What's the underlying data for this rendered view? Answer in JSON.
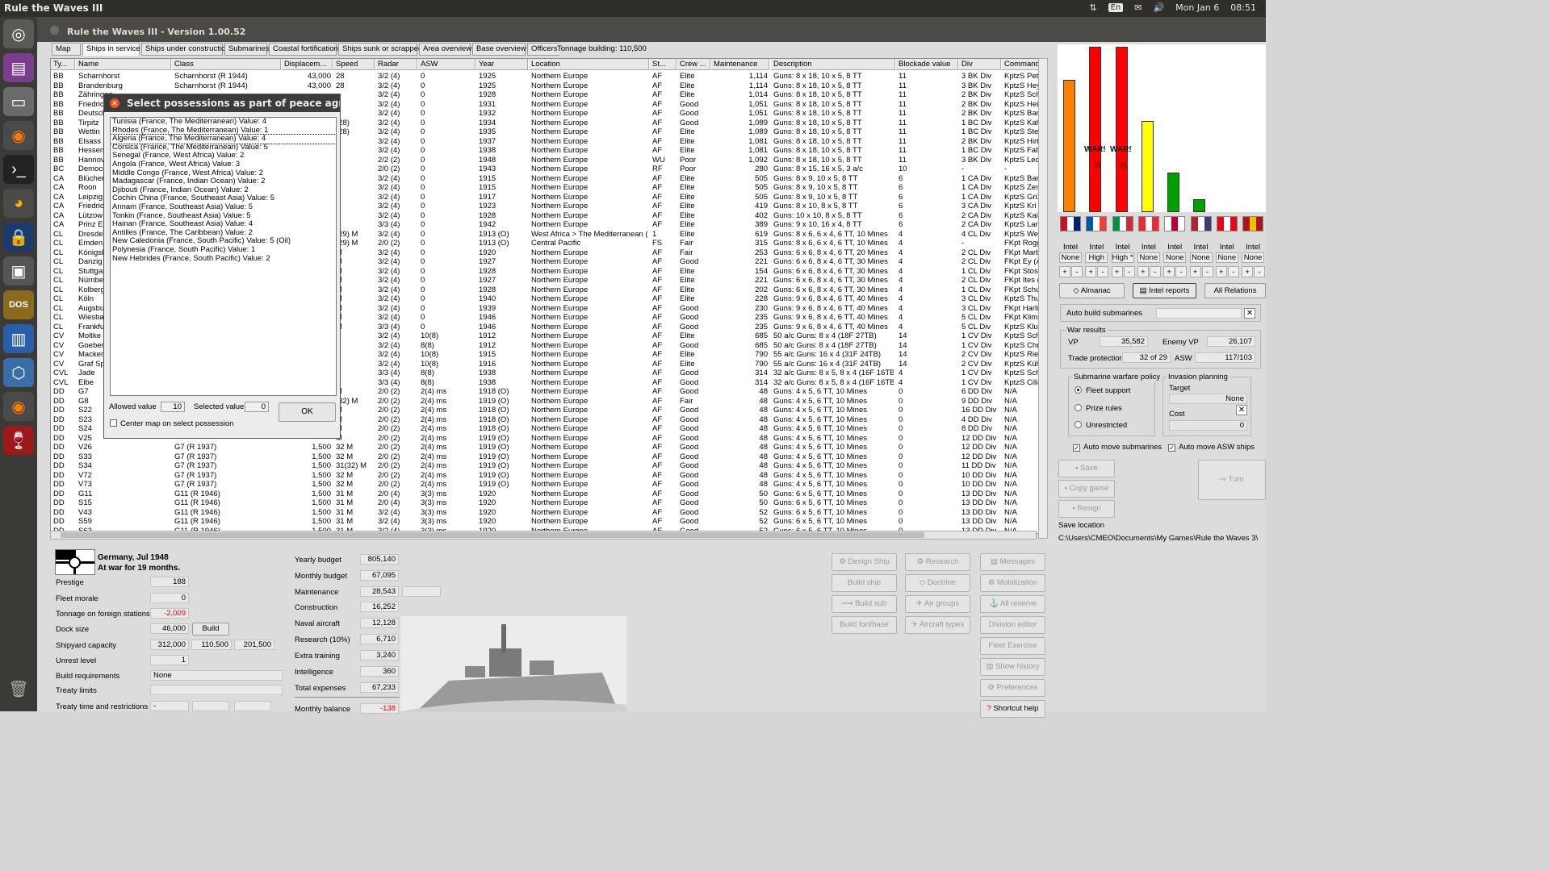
{
  "topbar": {
    "app_title": "Rule the Waves III",
    "keyboard": "En",
    "date": "Mon Jan 6",
    "time": "08:51"
  },
  "window": {
    "title": "Rule the Waves III - Version 1.00.52"
  },
  "tabs": [
    "Map",
    "Ships in service",
    "Ships under construction",
    "Submarines",
    "Coastal fortifications",
    "Ships sunk or scrapped",
    "Area overview",
    "Base overview",
    "Officers",
    "Tonnage building: 110,500"
  ],
  "columns": [
    "Ty...",
    "Name",
    "Class",
    "Displacem...",
    "Speed",
    "Radar",
    "ASW",
    "Year",
    "Location",
    "St...",
    "Crew ...",
    "Maintenance",
    "Description",
    "Blockade value",
    "Div",
    "Command"
  ],
  "ships": [
    [
      "BB",
      "Scharnhorst",
      "Scharnhorst (R 1944)",
      "43,000",
      "28",
      "3/2 (4)",
      "0",
      "1925",
      "Northern Europe",
      "AF",
      "Elite",
      "1,114",
      "Guns: 8 x 18, 10 x 5, 8 TT",
      "11",
      "3 BK Div",
      "KptzS Pet"
    ],
    [
      "BB",
      "Brandenburg",
      "Scharnhorst (R 1944)",
      "43,000",
      "28",
      "3/2 (4)",
      "0",
      "1925",
      "Northern Europe",
      "AF",
      "Elite",
      "1,114",
      "Guns: 8 x 18, 10 x 5, 8 TT",
      "11",
      "3 BK Div",
      "KptzS Hey"
    ],
    [
      "BB",
      "Zähringen",
      "",
      "",
      "",
      "3/2 (4)",
      "0",
      "1928",
      "Northern Europe",
      "AF",
      "Elite",
      "1,014",
      "Guns: 8 x 18, 10 x 5, 8 TT",
      "11",
      "2 BK Div",
      "KptzS Sch"
    ],
    [
      "BB",
      "Friedrich",
      "",
      "",
      "",
      "3/2 (4)",
      "0",
      "1931",
      "Northern Europe",
      "AF",
      "Good",
      "1,051",
      "Guns: 8 x 18, 10 x 5, 8 TT",
      "11",
      "2 BK Div",
      "KptzS Hei"
    ],
    [
      "BB",
      "Deutsch",
      "",
      "",
      "",
      "3/2 (4)",
      "0",
      "1932",
      "Northern Europe",
      "AF",
      "Good",
      "1,051",
      "Guns: 8 x 18, 10 x 5, 8 TT",
      "11",
      "2 BK Div",
      "KptzS Ban"
    ],
    [
      "BB",
      "Tirpitz",
      "",
      "",
      "(28)",
      "3/2 (4)",
      "0",
      "1934",
      "Northern Europe",
      "AF",
      "Good",
      "1,089",
      "Guns: 8 x 18, 10 x 5, 8 TT",
      "11",
      "1 BC Div",
      "KptzS Kah"
    ],
    [
      "BB",
      "Wettin",
      "",
      "",
      "(28)",
      "3/2 (4)",
      "0",
      "1935",
      "Northern Europe",
      "AF",
      "Elite",
      "1,089",
      "Guns: 8 x 18, 10 x 5, 8 TT",
      "11",
      "1 BC Div",
      "KptzS Ste"
    ],
    [
      "BB",
      "Elsass",
      "",
      "",
      "",
      "3/2 (4)",
      "0",
      "1937",
      "Northern Europe",
      "AF",
      "Elite",
      "1,081",
      "Guns: 8 x 18, 10 x 5, 8 TT",
      "11",
      "2 BK Div",
      "KptzS Hirt"
    ],
    [
      "BB",
      "Hessen",
      "",
      "",
      "",
      "3/2 (4)",
      "0",
      "1938",
      "Northern Europe",
      "AF",
      "Elite",
      "1,081",
      "Guns: 8 x 18, 10 x 5, 8 TT",
      "11",
      "1 BC Div",
      "KptzS Fab"
    ],
    [
      "BB",
      "Hannov",
      "",
      "",
      "",
      "2/2 (2)",
      "0",
      "1948",
      "Northern Europe",
      "WU",
      "Poor",
      "1,092",
      "Guns: 8 x 18, 10 x 5, 8 TT",
      "11",
      "3 BK Div",
      "KptzS Lec"
    ],
    [
      "BC",
      "Democr",
      "",
      "",
      "",
      "2/0 (2)",
      "0",
      "1943",
      "Northern Europe",
      "RF",
      "Poor",
      "280",
      "Guns: 8 x 15, 16 x 5, 3 a/c",
      "10",
      "-",
      "-"
    ],
    [
      "CA",
      "Blücher",
      "",
      "",
      "",
      "3/2 (4)",
      "0",
      "1915",
      "Northern Europe",
      "AF",
      "Elite",
      "505",
      "Guns: 8 x 9, 10 x 5, 8 TT",
      "6",
      "1 CA Div",
      "KptzS Bar"
    ],
    [
      "CA",
      "Roon",
      "",
      "",
      "",
      "3/2 (4)",
      "0",
      "1915",
      "Northern Europe",
      "AF",
      "Elite",
      "505",
      "Guns: 8 x 9, 10 x 5, 8 TT",
      "6",
      "1 CA Div",
      "KptzS Zen"
    ],
    [
      "CA",
      "Leipzig",
      "",
      "",
      "",
      "3/2 (4)",
      "0",
      "1917",
      "Northern Europe",
      "AF",
      "Elite",
      "505",
      "Guns: 8 x 9, 10 x 5, 8 TT",
      "6",
      "1 CA Div",
      "KptzS Grü"
    ],
    [
      "CA",
      "Friedrich",
      "",
      "",
      "",
      "3/2 (4)",
      "0",
      "1923",
      "Northern Europe",
      "AF",
      "Elite",
      "419",
      "Guns: 8 x 10, 8 x 5, 8 TT",
      "6",
      "3 CA Div",
      "KptzS Kri"
    ],
    [
      "CA",
      "Lützow",
      "",
      "",
      "",
      "3/2 (4)",
      "0",
      "1928",
      "Northern Europe",
      "AF",
      "Elite",
      "402",
      "Guns: 10 x 10, 8 x 5, 8 TT",
      "6",
      "2 CA Div",
      "KptzS Kais"
    ],
    [
      "CA",
      "Prinz Eu",
      "",
      "",
      "",
      "3/3 (4)",
      "0",
      "1942",
      "Northern Europe",
      "AF",
      "Elite",
      "389",
      "Guns: 9 x 10, 16 x 4, 8 TT",
      "6",
      "2 CA Div",
      "KptzS Lan"
    ],
    [
      "CL",
      "Dresden",
      "",
      "",
      "(29) M",
      "3/2 (4)",
      "0",
      "1913 (O)",
      "West Africa > The Mediterranean (...",
      "1",
      "Elite",
      "619",
      "Guns: 8 x 6, 6 x 4, 6 TT, 10 Mines",
      "4",
      "4 CL Div",
      "KptzS We"
    ],
    [
      "CL",
      "Emden",
      "",
      "",
      "(29) M",
      "2/0 (2)",
      "0",
      "1913 (O)",
      "Central Pacific",
      "FS",
      "Fair",
      "315",
      "Guns: 8 x 6, 6 x 4, 6 TT, 10 Mines",
      "4",
      "-",
      "FKpt Rogg"
    ],
    [
      "CL",
      "Königsb",
      "",
      "",
      "M",
      "3/2 (4)",
      "0",
      "1920",
      "Northern Europe",
      "AF",
      "Fair",
      "253",
      "Guns: 6 x 6, 8 x 4, 6 TT, 20 Mines",
      "4",
      "2 CL Div",
      "FKpt Marb"
    ],
    [
      "CL",
      "Danzig",
      "",
      "",
      "M",
      "3/2 (4)",
      "0",
      "1927",
      "Northern Europe",
      "AF",
      "Good",
      "221",
      "Guns: 6 x 6, 8 x 4, 6 TT, 30 Mines",
      "4",
      "2 CL Div",
      "FKpt Ey (A"
    ],
    [
      "CL",
      "Stuttgart",
      "",
      "",
      "M",
      "3/2 (4)",
      "0",
      "1928",
      "Northern Europe",
      "AF",
      "Elite",
      "154",
      "Guns: 6 x 6, 8 x 4, 6 TT, 30 Mines",
      "4",
      "1 CL Div",
      "FKpt Stosc"
    ],
    [
      "CL",
      "Nürnber",
      "",
      "",
      "M",
      "3/2 (4)",
      "0",
      "1927",
      "Northern Europe",
      "AF",
      "Elite",
      "221",
      "Guns: 6 x 6, 8 x 4, 6 TT, 30 Mines",
      "4",
      "2 CL Div",
      "FKpt Ites ("
    ],
    [
      "CL",
      "Kolberg",
      "",
      "",
      "M",
      "3/2 (4)",
      "0",
      "1928",
      "Northern Europe",
      "AF",
      "Elite",
      "202",
      "Guns: 6 x 6, 8 x 4, 6 TT, 30 Mines",
      "4",
      "1 CL Div",
      "FKpt Schu"
    ],
    [
      "CL",
      "Köln",
      "",
      "",
      "M",
      "3/2 (4)",
      "0",
      "1940",
      "Northern Europe",
      "AF",
      "Elite",
      "228",
      "Guns: 9 x 6, 8 x 4, 6 TT, 40 Mines",
      "4",
      "3 CL Div",
      "KptzS Thu"
    ],
    [
      "CL",
      "Augsbur",
      "",
      "",
      "M",
      "3/2 (4)",
      "0",
      "1939",
      "Northern Europe",
      "AF",
      "Good",
      "230",
      "Guns: 9 x 6, 8 x 4, 6 TT, 40 Mines",
      "4",
      "3 CL Div",
      "FKpt Harlir"
    ],
    [
      "CL",
      "Wiesbac",
      "",
      "",
      "M",
      "3/2 (4)",
      "0",
      "1946",
      "Northern Europe",
      "AF",
      "Good",
      "235",
      "Guns: 9 x 6, 8 x 4, 6 TT, 40 Mines",
      "4",
      "5 CL Div",
      "FKpt Klimn"
    ],
    [
      "CL",
      "Frankfu",
      "",
      "",
      "M",
      "3/3 (4)",
      "0",
      "1946",
      "Northern Europe",
      "AF",
      "Good",
      "235",
      "Guns: 9 x 6, 8 x 4, 6 TT, 40 Mines",
      "4",
      "5 CL Div",
      "KptzS Klug"
    ],
    [
      "CV",
      "Moltke",
      "",
      "",
      "",
      "3/2 (4)",
      "10(8)",
      "1912",
      "Northern Europe",
      "AF",
      "Elite",
      "685",
      "50 a/c Guns: 8 x 4  (18F 27TB)",
      "14",
      "1 CV Div",
      "KptzS Sch"
    ],
    [
      "CV",
      "Goeben",
      "",
      "",
      "",
      "3/2 (4)",
      "8(8)",
      "1912",
      "Northern Europe",
      "AF",
      "Good",
      "685",
      "50 a/c Guns: 8 x 4  (18F 27TB)",
      "14",
      "1 CV Div",
      "KptzS Chri"
    ],
    [
      "CV",
      "Macken",
      "",
      "",
      "",
      "3/2 (4)",
      "10(8)",
      "1915",
      "Northern Europe",
      "AF",
      "Elite",
      "790",
      "55 a/c Guns: 16 x 4  (31F 24TB)",
      "14",
      "2 CV Div",
      "KptzS Rie"
    ],
    [
      "CV",
      "Graf Spe",
      "",
      "",
      "",
      "3/2 (4)",
      "10(8)",
      "1916",
      "Northern Europe",
      "AF",
      "Elite",
      "790",
      "55 a/c Guns: 16 x 4  (31F 24TB)",
      "14",
      "2 CV Div",
      "KptzS Küh"
    ],
    [
      "CVL",
      "Jade",
      "",
      "",
      "",
      "3/3 (4)",
      "8(8)",
      "1938",
      "Northern Europe",
      "AF",
      "Good",
      "314",
      "32 a/c Guns: 8 x 5, 8 x 4  (16F 16TB)",
      "4",
      "1 CV Div",
      "KptzS Sch"
    ],
    [
      "CVL",
      "Elbe",
      "",
      "",
      "",
      "3/3 (4)",
      "8(8)",
      "1938",
      "Northern Europe",
      "AF",
      "Good",
      "314",
      "32 a/c Guns: 8 x 5, 8 x 4  (16F 16TB)",
      "4",
      "1 CV Div",
      "KptzS Cilia"
    ],
    [
      "DD",
      "G7",
      "",
      "",
      "M",
      "2/0 (2)",
      "2(4) ms",
      "1918 (O)",
      "Northern Europe",
      "AF",
      "Good",
      "48",
      "Guns: 4 x 5, 6 TT, 10 Mines",
      "0",
      "6 DD Div",
      "N/A"
    ],
    [
      "DD",
      "G8",
      "",
      "",
      "(32) M",
      "2/0 (2)",
      "2(4) ms",
      "1919 (O)",
      "Northern Europe",
      "AF",
      "Fair",
      "48",
      "Guns: 4 x 5, 6 TT, 10 Mines",
      "0",
      "9 DD Div",
      "N/A"
    ],
    [
      "DD",
      "S22",
      "",
      "",
      "M",
      "2/0 (2)",
      "2(4) ms",
      "1918 (O)",
      "Northern Europe",
      "AF",
      "Good",
      "48",
      "Guns: 4 x 5, 6 TT, 10 Mines",
      "0",
      "16 DD Div",
      "N/A"
    ],
    [
      "DD",
      "S23",
      "",
      "",
      "M",
      "2/0 (2)",
      "2(4) ms",
      "1918 (O)",
      "Northern Europe",
      "AF",
      "Good",
      "48",
      "Guns: 4 x 5, 6 TT, 10 Mines",
      "0",
      "4 DD Div",
      "N/A"
    ],
    [
      "DD",
      "S24",
      "",
      "",
      "M",
      "2/0 (2)",
      "2(4) ms",
      "1918 (O)",
      "Northern Europe",
      "AF",
      "Good",
      "48",
      "Guns: 4 x 5, 6 TT, 10 Mines",
      "0",
      "8 DD Div",
      "N/A"
    ],
    [
      "DD",
      "V25",
      "",
      "",
      "M",
      "2/0 (2)",
      "2(4) ms",
      "1919 (O)",
      "Northern Europe",
      "AF",
      "Good",
      "48",
      "Guns: 4 x 5, 6 TT, 10 Mines",
      "0",
      "12 DD Div",
      "N/A"
    ],
    [
      "DD",
      "V26",
      "G7 (R 1937)",
      "1,500",
      "32 M",
      "2/0 (2)",
      "2(4) ms",
      "1919 (O)",
      "Northern Europe",
      "AF",
      "Good",
      "48",
      "Guns: 4 x 5, 6 TT, 10 Mines",
      "0",
      "12 DD Div",
      "N/A"
    ],
    [
      "DD",
      "S33",
      "G7 (R 1937)",
      "1,500",
      "32 M",
      "2/0 (2)",
      "2(4) ms",
      "1919 (O)",
      "Northern Europe",
      "AF",
      "Good",
      "48",
      "Guns: 4 x 5, 6 TT, 10 Mines",
      "0",
      "12 DD Div",
      "N/A"
    ],
    [
      "DD",
      "S34",
      "G7 (R 1937)",
      "1,500",
      "31(32) M",
      "2/0 (2)",
      "2(4) ms",
      "1919 (O)",
      "Northern Europe",
      "AF",
      "Good",
      "48",
      "Guns: 4 x 5, 6 TT, 10 Mines",
      "0",
      "11 DD Div",
      "N/A"
    ],
    [
      "DD",
      "V72",
      "G7 (R 1937)",
      "1,500",
      "32 M",
      "2/0 (2)",
      "2(4) ms",
      "1919 (O)",
      "Northern Europe",
      "AF",
      "Good",
      "48",
      "Guns: 4 x 5, 6 TT, 10 Mines",
      "0",
      "10 DD Div",
      "N/A"
    ],
    [
      "DD",
      "V73",
      "G7 (R 1937)",
      "1,500",
      "32 M",
      "2/0 (2)",
      "2(4) ms",
      "1919 (O)",
      "Northern Europe",
      "AF",
      "Good",
      "48",
      "Guns: 4 x 5, 6 TT, 10 Mines",
      "0",
      "10 DD Div",
      "N/A"
    ],
    [
      "DD",
      "G11",
      "G11 (R 1946)",
      "1,500",
      "31 M",
      "2/0 (4)",
      "3(3) ms",
      "1920",
      "Northern Europe",
      "AF",
      "Good",
      "50",
      "Guns: 6 x 5, 6 TT, 10 Mines",
      "0",
      "13 DD Div",
      "N/A"
    ],
    [
      "DD",
      "S15",
      "G11 (R 1946)",
      "1,500",
      "31 M",
      "2/0 (4)",
      "3(3) ms",
      "1920",
      "Northern Europe",
      "AF",
      "Good",
      "50",
      "Guns: 6 x 5, 6 TT, 10 Mines",
      "0",
      "13 DD Div",
      "N/A"
    ],
    [
      "DD",
      "V43",
      "G11 (R 1946)",
      "1,500",
      "31 M",
      "3/2 (4)",
      "3(3) ms",
      "1920",
      "Northern Europe",
      "AF",
      "Good",
      "52",
      "Guns: 6 x 5, 6 TT, 10 Mines",
      "0",
      "13 DD Div",
      "N/A"
    ],
    [
      "DD",
      "S59",
      "G11 (R 1946)",
      "1,500",
      "31 M",
      "3/2 (4)",
      "3(3) ms",
      "1920",
      "Northern Europe",
      "AF",
      "Good",
      "52",
      "Guns: 6 x 5, 6 TT, 10 Mines",
      "0",
      "13 DD Div",
      "N/A"
    ],
    [
      "DD",
      "S63",
      "G11 (R 1946)",
      "1,500",
      "31 M",
      "3/2 (4)",
      "3(3) ms",
      "1920",
      "Northern Europe",
      "AF",
      "Good",
      "52",
      "Guns: 6 x 5, 6 TT, 10 Mines",
      "0",
      "13 DD Div",
      "N/A"
    ]
  ],
  "dialog": {
    "title": "Select possessions as part of peace agreeme",
    "items": [
      "Tunisia (France, The Mediterranean) Value: 4",
      "Rhodes (France, The Mediterranean) Value: 1",
      "Algeria (France, The Mediterranean) Value: 4",
      "Corsica (France, The Mediterranean) Value: 5",
      "Senegal (France, West Africa) Value: 2",
      "Angola (France, West Africa) Value: 3",
      "Middle Congo (France, West Africa) Value: 2",
      "Madagascar (France, Indian Ocean) Value: 2",
      "Djibouti (France, Indian Ocean) Value: 2",
      "Cochin China (France, Southeast Asia) Value: 5",
      "Annam (France, Southeast Asia) Value: 5",
      "Tonkin (France, Southeast Asia) Value: 5",
      "Hainan (France, Southeast Asia) Value: 4",
      "Antilles (France, The Caribbean) Value: 2",
      "New Caledonia (France, South Pacific) Value: 5 (Oil)",
      "Polynesia (France, South Pacific) Value: 1",
      "New Hebrides (France, South Pacific) Value: 2"
    ],
    "allowed_label": "Allowed value",
    "allowed_value": "10",
    "selected_label": "Selected value",
    "selected_value": "0",
    "center_map_label": "Center map on select possession",
    "ok_label": "OK"
  },
  "nation": {
    "name": "Germany, Jul 1948",
    "war_status": "At war for 19 months."
  },
  "left_stats": {
    "prestige_label": "Prestige",
    "prestige": "188",
    "morale_label": "Fleet morale",
    "morale": "0",
    "foreign_label": "Tonnage on foreign stations",
    "foreign": "-2,009",
    "dock_label": "Dock size",
    "dock": "46,000",
    "build_label": "Build",
    "shipyard_label": "Shipyard capacity",
    "shipyard1": "312,000",
    "shipyard2": "110,500",
    "shipyard3": "201,500",
    "unrest_label": "Unrest level",
    "unrest": "1",
    "buildreq_label": "Build requirements",
    "buildreq": "None",
    "treaty_label": "Treaty limits",
    "treatytime_label": "Treaty time and restrictions",
    "treatytime": "-"
  },
  "budget": {
    "yearly_label": "Yearly budget",
    "yearly": "805,140",
    "monthly_label": "Monthly budget",
    "monthly": "67,095",
    "maint_label": "Maintenance",
    "maint": "28,543",
    "constr_label": "Construction",
    "constr": "16,252",
    "aircraft_label": "Naval aircraft",
    "aircraft": "12,128",
    "research_label": "Research (10%)",
    "research": "6,710",
    "training_label": "Extra training",
    "training": "3,240",
    "intel_label": "Intelligence",
    "intel": "360",
    "total_label": "Total expenses",
    "total": "67,233",
    "balance_label": "Monthly balance",
    "balance": "-138"
  },
  "action_buttons": {
    "design": "Design Ship",
    "research": "Research",
    "messages": "Messages",
    "build_ship": "Build ship",
    "doctrine": "Doctrine",
    "mobilization": "Mobilization",
    "build_sub": "Build sub",
    "air_groups": "Air groups",
    "all_reserve": "All reserve",
    "build_fort": "Build fort/base",
    "aircraft_types": "Aircraft types",
    "division_editor": "Division editor",
    "fleet_exercise": "Fleet Exercise",
    "show_history": "Show history",
    "preferences": "Preferences",
    "shortcut_help": "Shortcut help"
  },
  "tension_chart": {
    "war_label": "WAR!",
    "b_label": "B",
    "values_percent": [
      80,
      100,
      100,
      55,
      24,
      8,
      0,
      0
    ],
    "colors": [
      "#ff8000",
      "#ff0000",
      "#ff0000",
      "#ffff00",
      "#00a000",
      "#00a000",
      "#ffffff",
      "#ffffff"
    ]
  },
  "nations": [
    {
      "flag": "uk-flag",
      "intel": "Intel",
      "level": "None"
    },
    {
      "flag": "france-flag",
      "intel": "Intel",
      "level": "High"
    },
    {
      "flag": "italy-flag",
      "intel": "Intel",
      "level": "High *"
    },
    {
      "flag": "austria-flag",
      "intel": "Intel",
      "level": "None"
    },
    {
      "flag": "japan-flag",
      "intel": "Intel",
      "level": "None"
    },
    {
      "flag": "usa-flag",
      "intel": "Intel",
      "level": "None"
    },
    {
      "flag": "ottoman-flag",
      "intel": "Intel",
      "level": "None"
    },
    {
      "flag": "spain-flag",
      "intel": "Intel",
      "level": "None"
    }
  ],
  "right_panel": {
    "almanac": "Almanac",
    "intel_reports": "Intel reports",
    "all_relations": "All Relations",
    "auto_build_subs": "Auto build submarines",
    "war_results": "War results",
    "vp_label": "VP",
    "vp": "35,582",
    "enemy_vp_label": "Enemy VP",
    "enemy_vp": "26,107",
    "trade_label": "Trade protection",
    "trade": "32 of 29",
    "asw_label": "ASW",
    "asw": "117/103",
    "sub_policy": "Submarine warfare policy",
    "fleet_support": "Fleet support",
    "prize_rules": "Prize rules",
    "unrestricted": "Unrestricted",
    "invasion": "Invasion planning",
    "target_label": "Target",
    "target": "None",
    "cost_label": "Cost",
    "cost": "0",
    "auto_move_subs": "Auto move submarines",
    "auto_move_asw": "Auto move ASW ships",
    "save": "Save",
    "copy_game": "Copy game",
    "resign": "Resign",
    "turn": "Turn",
    "save_location_label": "Save location",
    "save_location": "C:\\Users\\CMEO\\Documents\\My Games\\Rule the Waves 3\\"
  }
}
